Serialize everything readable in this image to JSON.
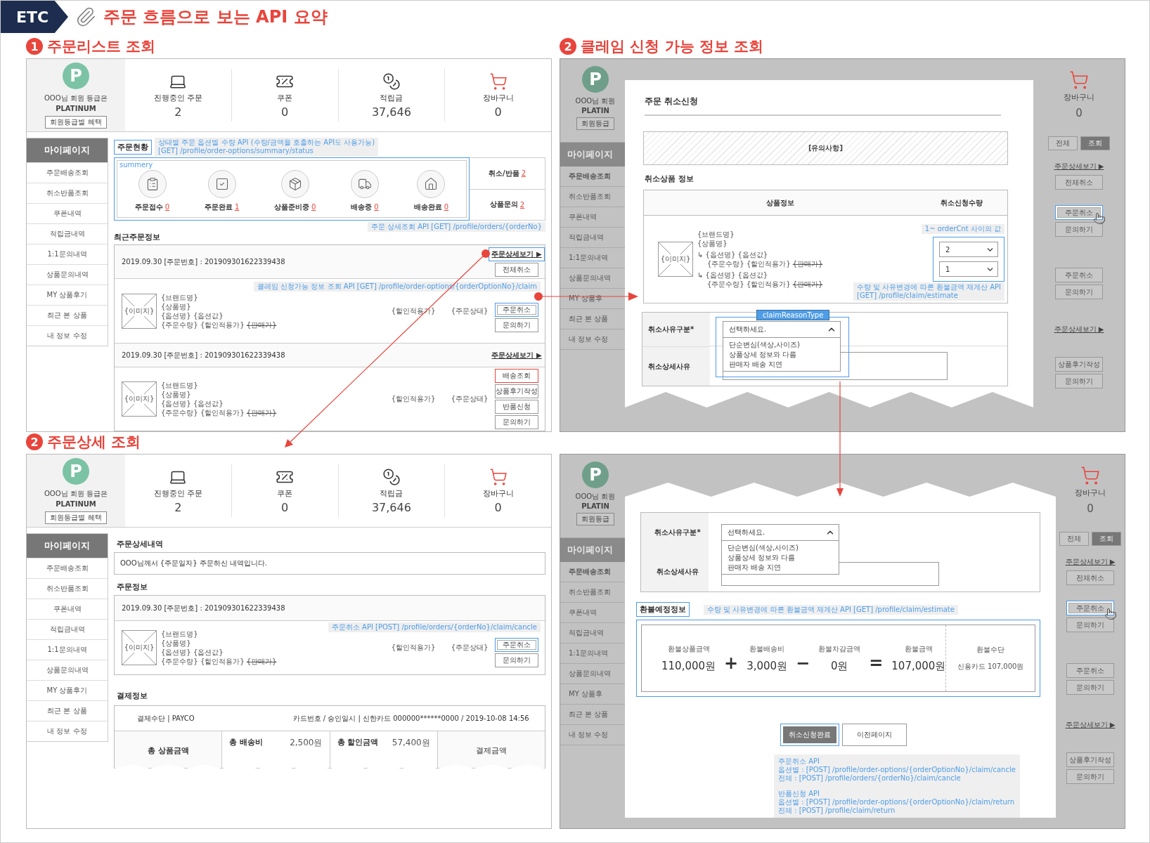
{
  "header": {
    "tag": "ETC",
    "title": "주문 흐름으로 보는 API 요약"
  },
  "order_list": {
    "number": "1",
    "title": "주문리스트 조회",
    "mypage": {
      "profile": {
        "avatar": "P",
        "greeting": "OOO님 회원 등급은",
        "grade": "PLATINUM",
        "benefit_button": "회원등급별 혜택"
      },
      "stats": [
        {
          "kind": "orders",
          "label": "진행중인 주문",
          "value": "2"
        },
        {
          "kind": "coupon",
          "label": "쿠폰",
          "value": "0"
        },
        {
          "kind": "points",
          "label": "적립금",
          "value": "37,646"
        },
        {
          "kind": "cart",
          "label": "장바구니",
          "value": "0"
        }
      ],
      "sidebar": {
        "title": "마이페이지",
        "items": [
          {
            "label": "주문배송조회",
            "selected": false
          },
          {
            "label": "취소반품조회",
            "selected": false
          },
          {
            "label": "쿠폰내역",
            "selected": false
          },
          {
            "label": "적립금내역",
            "selected": false
          },
          {
            "label": "1:1문의내역",
            "selected": false
          },
          {
            "label": "상품문의내역",
            "selected": false
          },
          {
            "label": "MY 상품후기",
            "selected": false
          },
          {
            "label": "최근 본 상품",
            "selected": false
          },
          {
            "label": "내 정보 수정",
            "selected": false
          }
        ]
      }
    },
    "status": {
      "title": "주문현황",
      "annotation": [
        "상태별 주문 옵션별 수량 API (수량/금액을 호출하는 API도 사용가능)",
        "[GET] /profile/order-options/summary/status"
      ],
      "summary_label": "summery",
      "steps": [
        {
          "kind": "received",
          "label": "주문접수",
          "count": "0"
        },
        {
          "kind": "completed",
          "label": "주문완료",
          "count": "1"
        },
        {
          "kind": "preparing",
          "label": "상품준비중",
          "count": "0"
        },
        {
          "kind": "shipping",
          "label": "배송중",
          "count": "0"
        },
        {
          "kind": "delivered",
          "label": "배송완료",
          "count": "0"
        }
      ],
      "side": [
        {
          "label": "취소/반품",
          "count": "2"
        },
        {
          "label": "상품문의",
          "count": "2"
        }
      ]
    },
    "detail_annotation": "주문 상세조회 API [GET] /profile/orders/{orderNo}",
    "recent": {
      "title": "최근주문정보",
      "orders": [
        {
          "date": "2019.09.30",
          "number_label": "[주문번호] :",
          "number": "201909301622339438",
          "detail_link": {
            "label": "주문상세보기 ▶",
            "highlighted": true
          },
          "header_buttons": [
            {
              "label": "전체취소",
              "kind": "outline",
              "highlighted": false
            }
          ],
          "annotation": "클레임 신청가능 정보 조회 API [GET] /profile/order-options/{orderOptionNo}/claim",
          "product": {
            "image": "{이미지}",
            "brand": "{브랜드명}",
            "name": "{상품명}",
            "option": "{옵션명} {옵션값}",
            "quantity": "{주문수량} {할인적용가}",
            "list_price": "{판매가}",
            "price": "{할인적용가}",
            "status": "{주문상태}"
          },
          "buttons": [
            {
              "label": "주문취소",
              "kind": "outline",
              "highlighted": true
            },
            {
              "label": "문의하기",
              "kind": "outline",
              "highlighted": false
            }
          ]
        },
        {
          "date": "2019.09.30",
          "number_label": "[주문번호] :",
          "number": "201909301622339438",
          "detail_link": {
            "label": "주문상세보기 ▶",
            "highlighted": false
          },
          "product": {
            "image": "{이미지}",
            "brand": "{브랜드명}",
            "name": "{상품명}",
            "option": "{옵션명} {옵션값}",
            "quantity": "{주문수량} {할인적용가}",
            "list_price": "{판매가}",
            "price": "{할인적용가}",
            "status": "{주문상태}"
          },
          "buttons": [
            {
              "label": "배송조회",
              "kind": "alert",
              "highlighted": false
            },
            {
              "label": "상품후기작성",
              "kind": "outline",
              "highlighted": false
            },
            {
              "label": "반품신청",
              "kind": "outline",
              "highlighted": false
            },
            {
              "label": "문의하기",
              "kind": "outline",
              "highlighted": false
            }
          ]
        }
      ]
    }
  },
  "claim_info": {
    "number": "2",
    "title": "클레임 신청 가능 정보 조회",
    "backdrop": {
      "profile": {
        "avatar": "P",
        "greeting": "OOO님 회원",
        "grade": "PLATIN",
        "benefit_button": "회원등급"
      },
      "sidebar": {
        "title": "마이페이지",
        "items": [
          {
            "label": "주문배송조회",
            "selected": true
          },
          {
            "label": "취소반품조회",
            "selected": false
          },
          {
            "label": "쿠폰내역",
            "selected": false
          },
          {
            "label": "적립금내역",
            "selected": false
          },
          {
            "label": "1:1문의내역",
            "selected": false
          },
          {
            "label": "상품문의내역",
            "selected": false
          },
          {
            "label": "MY 상품후",
            "selected": false
          },
          {
            "label": "최근 본 상품",
            "selected": false
          },
          {
            "label": "내 정보 수정",
            "selected": false
          }
        ]
      },
      "cart": {
        "label": "장바구니",
        "value": "0"
      },
      "filters": [
        {
          "label": "전체",
          "kind": "outline"
        },
        {
          "label": "조회",
          "kind": "dark"
        }
      ],
      "groups": [
        {
          "items": [
            {
              "kind": "link",
              "label": "주문상세보기 ▶",
              "highlighted": false
            },
            {
              "kind": "button",
              "label": "전체취소",
              "highlighted": false
            }
          ]
        },
        {
          "items": [
            {
              "kind": "button",
              "label": "주문취소",
              "highlighted": true
            },
            {
              "kind": "button",
              "label": "문의하기",
              "highlighted": false
            }
          ]
        },
        {
          "items": [
            {
              "kind": "button",
              "label": "주문취소",
              "highlighted": false
            },
            {
              "kind": "button",
              "label": "문의하기",
              "highlighted": false
            }
          ]
        },
        {
          "items": [
            {
              "kind": "link",
              "label": "주문상세보기 ▶",
              "highlighted": false
            }
          ]
        },
        {
          "items": [
            {
              "kind": "button",
              "label": "상품후기작성",
              "highlighted": false
            },
            {
              "kind": "button",
              "label": "문의하기",
              "highlighted": false
            }
          ]
        }
      ]
    },
    "modal": {
      "title": "주문 취소신청",
      "notice": "[유의사항]",
      "section": "취소상품 정보",
      "columns": [
        "상품정보",
        "취소신청수량"
      ],
      "product": {
        "image": "{이미지}",
        "brand": "{브랜드명}",
        "name": "{상품명}",
        "options": [
          {
            "option": "↳ {옵션명} {옵션값}",
            "quantity": "{주문수량} {할인적용가}",
            "list_price": "{판매가}"
          },
          {
            "option": "↳ {옵션명} {옵션값}",
            "quantity": "{주문수량} {할인적용가}",
            "list_price": "{판매가}"
          }
        ]
      },
      "quantities": [
        {
          "value": "2"
        },
        {
          "value": "1"
        }
      ],
      "quantity_annotation": "1~ orderCnt 사이의 값",
      "estimate_annotation": [
        "수량 및 사유변경에 따른 환불금액 재계산 API",
        "[GET] /profile/claim/estimate"
      ],
      "reason": {
        "label": "취소사유구분*",
        "tag": "claimReasonType",
        "value": "선택하세요.",
        "expanded": true,
        "options": [
          "단순변심(색상,사이즈)",
          "상품상세 정보와 다름",
          "판매자 배송 지연"
        ]
      },
      "detail_label": "취소상세사유"
    }
  },
  "order_detail": {
    "number": "2",
    "title": "주문상세 조회",
    "mypage": {
      "profile": {
        "avatar": "P",
        "greeting": "OOO님 회원 등급은",
        "grade": "PLATINUM",
        "benefit_button": "회원등급별 혜택"
      },
      "stats": [
        {
          "kind": "orders",
          "label": "진행중인 주문",
          "value": "2"
        },
        {
          "kind": "coupon",
          "label": "쿠폰",
          "value": "0"
        },
        {
          "kind": "points",
          "label": "적립금",
          "value": "37,646"
        },
        {
          "kind": "cart",
          "label": "장바구니",
          "value": "0"
        }
      ],
      "sidebar": {
        "title": "마이페이지",
        "items": [
          {
            "label": "주문배송조회",
            "selected": false
          },
          {
            "label": "취소반품조회",
            "selected": false
          },
          {
            "label": "쿠폰내역",
            "selected": false
          },
          {
            "label": "적립금내역",
            "selected": false
          },
          {
            "label": "1:1문의내역",
            "selected": false
          },
          {
            "label": "상품문의내역",
            "selected": false
          },
          {
            "label": "MY 상품후기",
            "selected": false
          },
          {
            "label": "최근 본 상품",
            "selected": false
          },
          {
            "label": "내 정보 수정",
            "selected": false
          }
        ]
      }
    },
    "detail_title": "주문상세내역",
    "message": "OOO님께서 {주문일자} 주문하신 내역입니다.",
    "order_title": "주문정보",
    "order": {
      "date": "2019.09.30",
      "number_label": "[주문번호] :",
      "number": "201909301622339438",
      "annotation": "주문취소 API [POST] /profile/orders/{orderNo}/claim/cancle",
      "product": {
        "image": "{이미지}",
        "brand": "{브랜드명}",
        "name": "{상품명}",
        "option": "{옵션명} {옵션값}",
        "quantity": "{주문수량} {할인적용가}",
        "list_price": "{판매가}",
        "price": "{할인적용가}",
        "status": "{주문상태}"
      },
      "buttons": [
        {
          "label": "주문취소",
          "kind": "outline",
          "highlighted": true
        },
        {
          "label": "문의하기",
          "kind": "outline",
          "highlighted": false
        }
      ]
    },
    "payment": {
      "title": "결제정보",
      "method": "결제수단 | PAYCO",
      "card": "카드번호 / 승인일시 |  신한카드 000000******0000 / 2019-10-08 14:56",
      "totals": [
        {
          "label": "총 상품금액"
        },
        {
          "label": "총 배송비",
          "amount": "2,500원"
        },
        {
          "label": "총 할인금액",
          "amount": "57,400원"
        },
        {
          "label": "결제금액"
        }
      ]
    }
  },
  "claim_submit": {
    "backdrop": {
      "profile": {
        "avatar": "P",
        "greeting": "OOO님 회원",
        "grade": "PLATIN",
        "benefit_button": "회원등급"
      },
      "sidebar": {
        "title": "마이페이지",
        "items": [
          {
            "label": "주문배송조회",
            "selected": true
          },
          {
            "label": "취소반품조회",
            "selected": false
          },
          {
            "label": "쿠폰내역",
            "selected": false
          },
          {
            "label": "적립금내역",
            "selected": false
          },
          {
            "label": "1:1문의내역",
            "selected": false
          },
          {
            "label": "상품문의내역",
            "selected": false
          },
          {
            "label": "MY 상품후",
            "selected": false
          },
          {
            "label": "최근 본 상품",
            "selected": false
          },
          {
            "label": "내 정보 수정",
            "selected": false
          }
        ]
      },
      "cart": {
        "label": "장바구니",
        "value": "0"
      },
      "filters": [
        {
          "label": "전체",
          "kind": "outline"
        },
        {
          "label": "조회",
          "kind": "dark"
        }
      ],
      "groups": [
        {
          "items": [
            {
              "kind": "link",
              "label": "주문상세보기 ▶",
              "highlighted": false
            },
            {
              "kind": "button",
              "label": "전체취소",
              "highlighted": false
            }
          ]
        },
        {
          "items": [
            {
              "kind": "button",
              "label": "주문취소",
              "highlighted": true
            },
            {
              "kind": "button",
              "label": "문의하기",
              "highlighted": false
            }
          ]
        },
        {
          "items": [
            {
              "kind": "button",
              "label": "주문취소",
              "highlighted": false
            },
            {
              "kind": "button",
              "label": "문의하기",
              "highlighted": false
            }
          ]
        },
        {
          "items": [
            {
              "kind": "link",
              "label": "주문상세보기 ▶",
              "highlighted": false
            }
          ]
        },
        {
          "items": [
            {
              "kind": "button",
              "label": "상품후기작성",
              "highlighted": false
            },
            {
              "kind": "button",
              "label": "문의하기",
              "highlighted": false
            }
          ]
        }
      ]
    },
    "modal": {
      "reason": {
        "label": "취소사유구분*",
        "value": "선택하세요.",
        "expanded": true,
        "options": [
          "단순변심(색상,사이즈)",
          "상품상세 정보와 다름",
          "판매자 배송 지연"
        ]
      },
      "detail_label": "취소상세사유",
      "refund": {
        "title": "환불예정정보",
        "annotation": "수량 및 사유변경에 따른 환불금액 재계산 API [GET] /profile/claim/estimate",
        "terms": [
          {
            "label": "환불상품금액",
            "amount": "110,000원",
            "operator": "+"
          },
          {
            "label": "환불배송비",
            "amount": "3,000원",
            "operator": "−"
          },
          {
            "label": "환불차감금액",
            "amount": "0원",
            "operator": "="
          },
          {
            "label": "환불금액",
            "amount": "107,000원"
          }
        ],
        "method_label": "환불수단",
        "method": "신용카드  107,000원"
      },
      "buttons": [
        {
          "label": "취소신청완료",
          "kind": "primary",
          "highlighted": true
        },
        {
          "label": "이전페이지",
          "kind": "outline",
          "highlighted": false
        }
      ],
      "api_notes": [
        {
          "title": "주문취소 API",
          "lines": [
            "옵션별 : [POST] /profile/order-options/{orderOptionNo}/claim/cancle",
            "전체 : [POST] /profile/orders/{orderNo}/claim/cancle"
          ]
        },
        {
          "title": "반품신청 API",
          "lines": [
            "옵션별 : [POST] /profile/order-options/{orderOptionNo}/claim/return",
            "전체 : [POST] /profile/claim/return"
          ]
        }
      ]
    }
  }
}
